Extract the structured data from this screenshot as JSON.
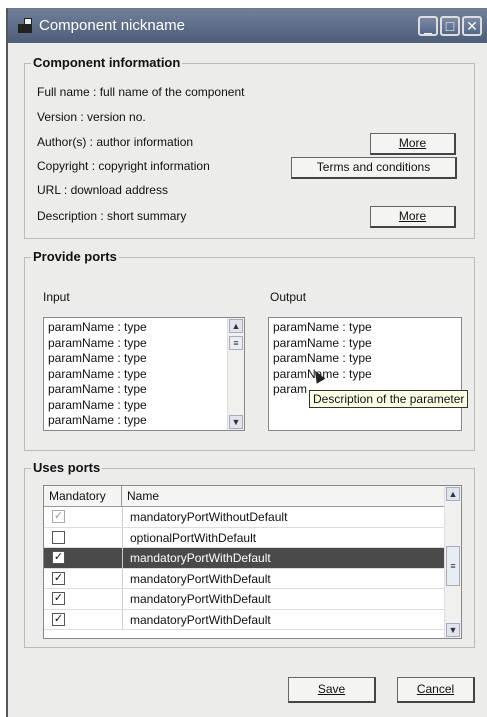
{
  "window": {
    "title": "Component nickname"
  },
  "component_info": {
    "legend": "Component information",
    "full_name": "Full name : full name of the component",
    "version": "Version : version no.",
    "authors": "Author(s) : author information",
    "copyright": "Copyright : copyright information",
    "url": "URL : download address",
    "description": "Description : short summary",
    "more_label_1": "More",
    "terms_label": "Terms and conditions",
    "more_label_2": "More"
  },
  "provide_ports": {
    "legend": "Provide ports",
    "input_label": "Input",
    "output_label": "Output",
    "input_items": [
      "paramName : type",
      "paramName : type",
      "paramName : type",
      "paramName : type",
      "paramName : type",
      "paramName : type",
      "paramName : type"
    ],
    "output_items": [
      "paramName : type",
      "paramName : type",
      "paramName : type",
      "paramName : type",
      "param"
    ],
    "tooltip": "Description of the parameter"
  },
  "uses_ports": {
    "legend": "Uses ports",
    "columns": [
      "Mandatory",
      "Name"
    ],
    "rows": [
      {
        "checked": true,
        "disabled": true,
        "name": "mandatoryPortWithoutDefault",
        "selected": false
      },
      {
        "checked": false,
        "disabled": false,
        "name": "optionalPortWithDefault",
        "selected": false
      },
      {
        "checked": true,
        "disabled": false,
        "name": "mandatoryPortWithDefault",
        "selected": true
      },
      {
        "checked": true,
        "disabled": false,
        "name": "mandatoryPortWithDefault",
        "selected": false
      },
      {
        "checked": true,
        "disabled": false,
        "name": "mandatoryPortWithDefault",
        "selected": false
      },
      {
        "checked": true,
        "disabled": false,
        "name": "mandatoryPortWithDefault",
        "selected": false
      }
    ]
  },
  "footer": {
    "save_label": "Save",
    "cancel_label": "Cancel"
  }
}
